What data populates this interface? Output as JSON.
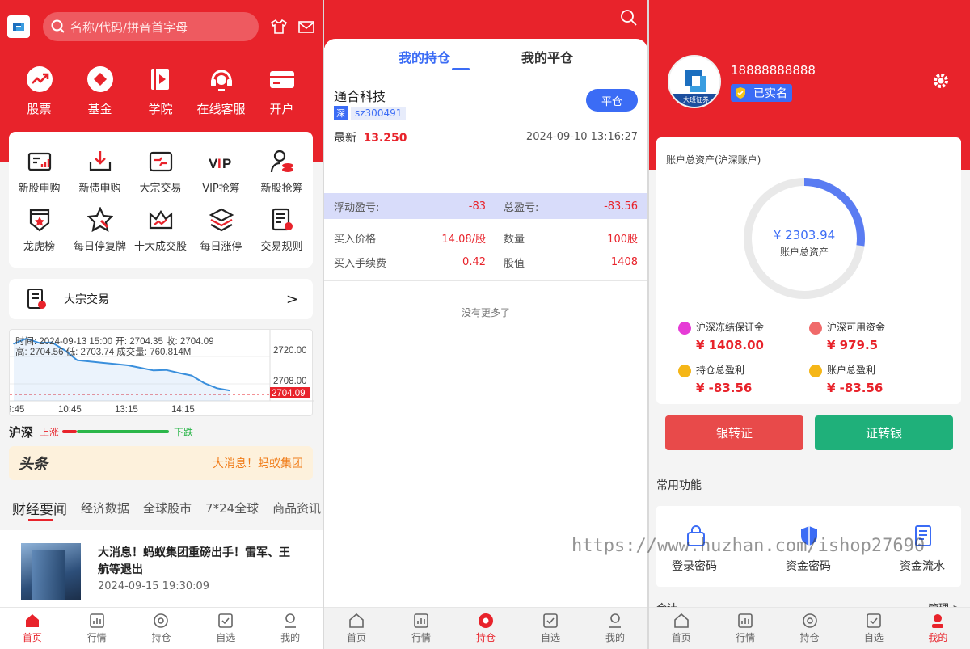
{
  "home": {
    "search_placeholder": "名称/代码/拼音首字母",
    "quick": [
      {
        "label": "股票",
        "icon": "trend-up-icon"
      },
      {
        "label": "基金",
        "icon": "diamond-icon"
      },
      {
        "label": "学院",
        "icon": "video-book-icon"
      },
      {
        "label": "在线客服",
        "icon": "headset-icon"
      },
      {
        "label": "开户",
        "icon": "card-icon"
      }
    ],
    "grid": [
      {
        "label": "新股申购",
        "icon": "ipo-chart-icon"
      },
      {
        "label": "新债申购",
        "icon": "download-tray-icon"
      },
      {
        "label": "大宗交易",
        "icon": "block-trade-icon"
      },
      {
        "label": "VIP抢筹",
        "icon": "vip-icon"
      },
      {
        "label": "新股抢筹",
        "icon": "person-coin-icon"
      },
      {
        "label": "龙虎榜",
        "icon": "shield-star-icon"
      },
      {
        "label": "每日停复牌",
        "icon": "star-cursor-icon"
      },
      {
        "label": "十大成交股",
        "icon": "crown-chart-icon"
      },
      {
        "label": "每日涨停",
        "icon": "layers-icon"
      },
      {
        "label": "交易规则",
        "icon": "rules-doc-icon"
      }
    ],
    "bulk_label": "大宗交易",
    "bulk_arrow": ">",
    "chart_info_1": "时间: 2024-09-13 15:00   开: 2704.35   收: 2704.09",
    "chart_info_2": "高: 2704.56   低: 2703.74   成交量: 760.814M",
    "market_label": "沪深",
    "up_label": "上涨",
    "down_label": "下跌",
    "toutiao_logo": "头条",
    "toutiao_text": "大消息！蚂蚁集团",
    "news_tabs": [
      "财经要闻",
      "经济数据",
      "全球股市",
      "7*24全球",
      "商品资讯"
    ],
    "news_title": "大消息！蚂蚁集团重磅出手！雷军、王航等退出",
    "news_time": "2024-09-15 19:30:09"
  },
  "chart_data": {
    "type": "line",
    "title": "",
    "x_ticks": [
      "9:45",
      "10:45",
      "13:15",
      "14:15"
    ],
    "y_ticks": [
      2720.0,
      2708.0
    ],
    "last_price_label": "2704.09",
    "ylim": [
      2700,
      2728
    ],
    "x": [
      "09:30",
      "09:45",
      "10:00",
      "10:15",
      "10:30",
      "10:45",
      "11:00",
      "11:15",
      "11:30",
      "13:00",
      "13:15",
      "13:30",
      "13:45",
      "14:00",
      "14:15",
      "14:30",
      "14:45",
      "15:00"
    ],
    "series": [
      {
        "values": [
          2722.5,
          2724.5,
          2722.8,
          2723.0,
          2720.0,
          2716.0,
          2715.5,
          2715.0,
          2714.5,
          2714.0,
          2713.0,
          2712.0,
          2712.2,
          2711.0,
          2710.0,
          2707.0,
          2705.0,
          2704.1
        ]
      }
    ]
  },
  "positions": {
    "tab_hold": "我的持仓",
    "tab_closed": "我的平仓",
    "stock_name": "通合科技",
    "market_tag": "深",
    "code": "sz300491",
    "close_btn": "平仓",
    "latest_label": "最新",
    "latest_value": "13.250",
    "datetime": "2024-09-10 13:16:27",
    "float_pl_label": "浮动盈亏:",
    "float_pl": "-83",
    "total_pl_label": "总盈亏:",
    "total_pl": "-83.56",
    "buy_price_label": "买入价格",
    "buy_price": "14.08/股",
    "qty_label": "数量",
    "qty": "100股",
    "fee_label": "买入手续费",
    "fee": "0.42",
    "value_label": "股值",
    "value": "1408",
    "no_more": "没有更多了"
  },
  "mine": {
    "phone": "18888888888",
    "verified": "已实名",
    "logo_text": "大班证券",
    "assets_title": "账户总资产(沪深账户)",
    "total_assets": "¥  2303.94",
    "total_assets_label": "账户总资产",
    "ring_fraction": 0.27,
    "stats": [
      {
        "label": "沪深冻结保证金",
        "value": "¥ 1408.00",
        "color": "#e63bd6"
      },
      {
        "label": "沪深可用资金",
        "value": "¥ 979.5",
        "color": "#f06a6a"
      },
      {
        "label": "持仓总盈利",
        "value": "¥ -83.56",
        "color": "#f5b617"
      },
      {
        "label": "账户总盈利",
        "value": "¥ -83.56",
        "color": "#f5b617"
      }
    ],
    "bank_to_sec": "银转证",
    "sec_to_bank": "证转银",
    "common_title": "常用功能",
    "functions": [
      {
        "label": "登录密码",
        "icon": "lock-bag-icon"
      },
      {
        "label": "资金密码",
        "icon": "shield-icon"
      },
      {
        "label": "资金流水",
        "icon": "list-doc-icon"
      }
    ],
    "more_left": "合计",
    "more_right": "管理 >"
  },
  "watermark": "https://www.huzhan.com/ishop27690",
  "tabbar": [
    "首页",
    "行情",
    "持仓",
    "自选",
    "我的"
  ],
  "colors": {
    "brand": "#e8232b",
    "green": "#1fb07a",
    "blue": "#3b6cf5"
  }
}
